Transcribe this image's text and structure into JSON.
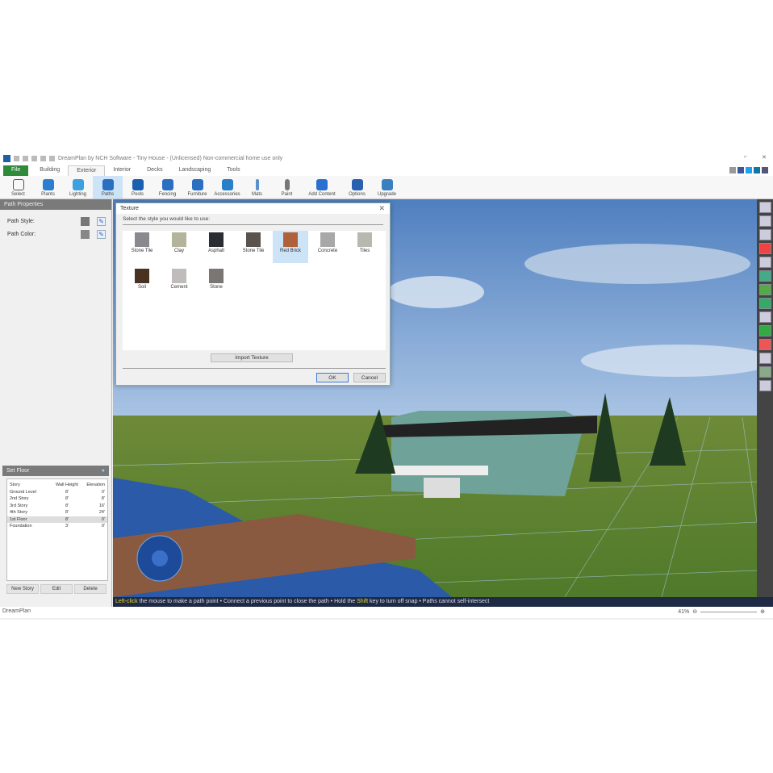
{
  "title": "DreamPlan by NCH Software - Tiny House - (Unlicensed) Non-commercial home use only",
  "tabs": [
    "File",
    "Building",
    "Exterior",
    "Interior",
    "Decks",
    "Landscaping",
    "Tools"
  ],
  "active_tab": "Exterior",
  "ribbon": [
    "Select",
    "Plants",
    "Lighting",
    "Paths",
    "Pools",
    "Fencing",
    "Furniture",
    "Accessories",
    "Mats",
    "Paint",
    "Add Content",
    "Options",
    "Upgrade"
  ],
  "ribbon_selected": "Paths",
  "path_properties": {
    "title": "Path Properties",
    "style_label": "Path Style:",
    "color_label": "Path Color:"
  },
  "floors": {
    "title": "Set Floor",
    "headers": [
      "Story",
      "Wall Height",
      "Elevation"
    ],
    "rows": [
      [
        "Ground Level",
        "8'",
        "0'"
      ],
      [
        "2nd Story",
        "8'",
        "8'"
      ],
      [
        "3rd Story",
        "8'",
        "16'"
      ],
      [
        "4th Story",
        "8'",
        "24'"
      ],
      [
        "1st Floor",
        "8'",
        "0'"
      ],
      [
        "Foundation",
        "3'",
        "0'"
      ]
    ],
    "selected_row": 4,
    "buttons": [
      "New Story",
      "Edit",
      "Delete"
    ]
  },
  "dialog": {
    "title": "Texture",
    "prompt": "Select the style you would like to use:",
    "textures": [
      {
        "name": "Stone Tile",
        "color": "#8a8a8e"
      },
      {
        "name": "Clay",
        "color": "#b4b49a"
      },
      {
        "name": "Asphalt",
        "color": "#2a2d33"
      },
      {
        "name": "Stone Tile",
        "color": "#5a524c"
      },
      {
        "name": "Red Brick",
        "color": "#b0603a"
      },
      {
        "name": "Concrete",
        "color": "#a8a8a8"
      },
      {
        "name": "Tiles",
        "color": "#b8b8b0"
      },
      {
        "name": "Soil",
        "color": "#4a3222"
      },
      {
        "name": "Cement",
        "color": "#c0bcbc"
      },
      {
        "name": "Stone",
        "color": "#7a7674"
      }
    ],
    "selected": 4,
    "import_label": "Import Texture",
    "ok": "OK",
    "cancel": "Cancel"
  },
  "hint": {
    "p1": "Left-click",
    "p2": " the mouse to make a path point • Connect a previous point to close the path • Hold the ",
    "p3": "Shift",
    "p4": " key to turn off snap • Paths cannot self-intersect"
  },
  "status": {
    "left": "DreamPlan",
    "zoom": "41%"
  }
}
